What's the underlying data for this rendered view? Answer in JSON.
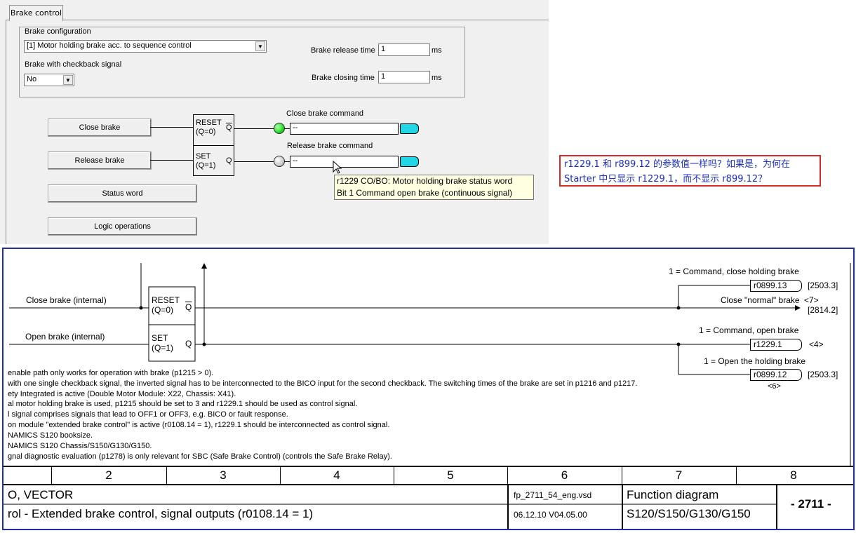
{
  "panel": {
    "tab_label": "Brake control",
    "group_title": "Brake  configuration",
    "brake_config_value": "[1] Motor holding brake acc. to sequence control",
    "checkback_label": "Brake with checkback signal",
    "checkback_value": "No",
    "release_time_label": "Brake release time",
    "release_time_value": "1",
    "closing_time_label": "Brake closing time",
    "closing_time_value": "1",
    "unit_ms": "ms",
    "close_brake_button": "Close brake",
    "release_brake_button": "Release brake",
    "status_word_button": "Status word",
    "logic_operations_button": "Logic operations",
    "reset_label": "RESET",
    "reset_sub": "(Q=0)",
    "set_label": "SET",
    "set_sub": "(Q=1)",
    "q_bar": "Q",
    "q": "Q",
    "close_cmd_label": "Close brake command",
    "release_cmd_label": "Release brake command",
    "close_cmd_value": "--",
    "release_cmd_value": "--",
    "tooltip_line1": "r1229 CO/BO: Motor holding brake status word",
    "tooltip_line2": "Bit 1 Command open brake (continuous signal)",
    "led_close_color": "#22dd22",
    "led_release_color": "#c8c8c8"
  },
  "note": {
    "text_line1": "r1229.1 和 r899.12 的参数值一样吗？如果是，为何在",
    "text_line2": "Starter 中只显示 r1229.1，而不显示 r899.12？"
  },
  "diagram": {
    "close_brake_internal": "Close brake (internal)",
    "open_brake_internal": "Open brake (internal)",
    "reset_label": "RESET",
    "reset_sub": "(Q=0)",
    "set_label": "SET",
    "set_sub": "(Q=1)",
    "q_bar": "Q",
    "q": "Q",
    "cmd_close_holding": "1 = Command, close holding brake",
    "param_0899_13": "r0899.13",
    "ref_2503_3a": "[2503.3]",
    "close_normal_brake": "Close \"normal\" brake",
    "ref_7": "<7>",
    "ref_2814_2": "[2814.2]",
    "cmd_open": "1 = Command, open brake",
    "param_1229_1": "r1229.1",
    "ref_4": "<4>",
    "open_holding": "1 = Open the holding brake",
    "param_0899_12": "r0899.12",
    "ref_2503_3b": "[2503.3]",
    "ref_6": "<6>",
    "notes": [
      "enable path only works for operation with brake (p1215 > 0).",
      "with one single checkback signal, the inverted signal has to be interconnected to the BICO input for the second checkback. The switching times of the brake are set in p1216 and p1217.",
      "ety Integrated is active (Double Motor Module: X22, Chassis: X41).",
      "al motor holding brake is used, p1215 should be set to 3 and r1229.1 should be used as control signal.",
      "l signal comprises signals that lead to OFF1 or OFF3, e.g. BICO or fault response.",
      "on module \"extended brake control\" is active (r0108.14 = 1), r1229.1 should be interconnected as control signal.",
      "NAMICS S120 booksize.",
      "NAMICS S120 Chassis/S150/G130/G150.",
      "gnal diagnostic evaluation (p1278) is only relevant for SBC (Safe Brake Control) (controls the Safe Brake Relay)."
    ],
    "grid_numbers": [
      "2",
      "3",
      "4",
      "5",
      "6",
      "7",
      "8"
    ],
    "footer_left1": "O, VECTOR",
    "footer_left2": "rol - Extended brake control, signal outputs (r0108.14 = 1)",
    "footer_file": "fp_2711_54_eng.vsd",
    "footer_date": "06.12.10  V04.05.00",
    "footer_fd": "Function diagram",
    "footer_devices": "S120/S150/G130/G150",
    "footer_number": "- 2711 -"
  }
}
